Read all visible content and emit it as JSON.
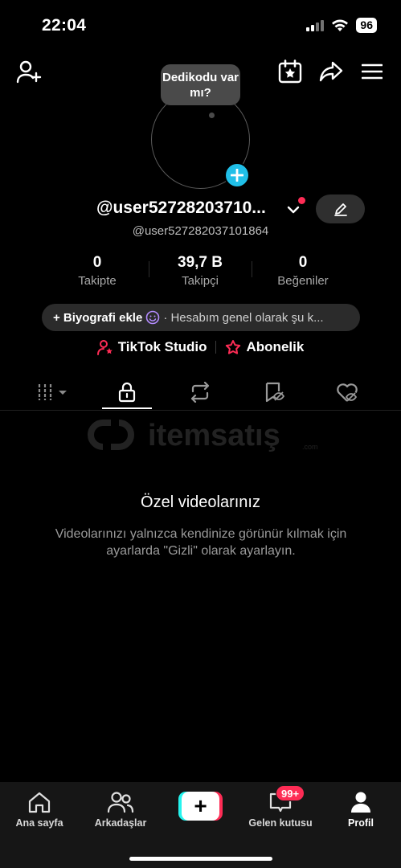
{
  "status_bar": {
    "time": "22:04",
    "battery": "96"
  },
  "profile": {
    "bubble_text": "Dedikodu var mı?",
    "username": "@user52728203710...",
    "handle": "@user527282037101864"
  },
  "stats": [
    {
      "value": "0",
      "label": "Takipte"
    },
    {
      "value": "39,7 B",
      "label": "Takipçi"
    },
    {
      "value": "0",
      "label": "Beğeniler"
    }
  ],
  "bio": {
    "add_label": "+ Biyografi ekle",
    "suggestion": "· Hesabım genel olarak şu k..."
  },
  "links": {
    "studio": "TikTok Studio",
    "subscription": "Abonelik"
  },
  "watermark": {
    "text": "itemsatış",
    "suffix": ".com"
  },
  "empty_state": {
    "title": "Özel videolarınız",
    "description": "Videolarınızı yalnızca kendinize görünür kılmak için ayarlarda \"Gizli\" olarak ayarlayın."
  },
  "bottom_nav": {
    "home": "Ana sayfa",
    "friends": "Arkadaşlar",
    "inbox": "Gelen kutusu",
    "inbox_badge": "99+",
    "profile": "Profil"
  },
  "colors": {
    "accent_red": "#fe2c55",
    "accent_cyan": "#25f4ee",
    "avatar_plus": "#20bfe8"
  }
}
